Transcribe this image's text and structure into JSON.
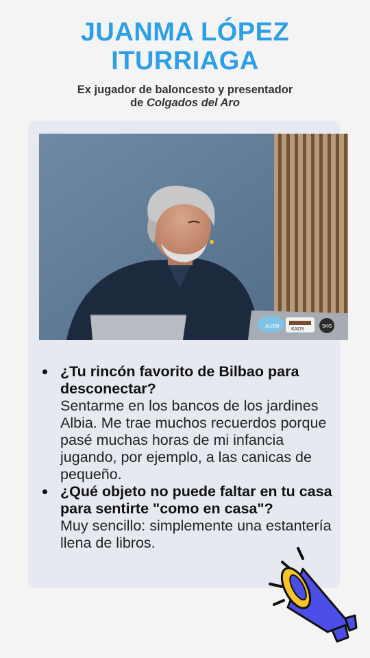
{
  "header": {
    "title_line1": "JUANMA LÓPEZ",
    "title_line2": "ITURRIAGA",
    "subtitle_line1": "Ex jugador de baloncesto y presentador",
    "subtitle_prefix": "de",
    "subtitle_show": "Colgados del Aro"
  },
  "photo": {
    "laptop_stickers": [
      "ALIEN",
      "KAOS",
      "SKG"
    ]
  },
  "qa": [
    {
      "question": "¿Tu rincón favorito de Bilbao para desconectar?",
      "answer": "Sentarme en los bancos de los jardines Albia. Me trae muchos recuerdos porque pasé muchas horas de mi infancia jugando, por ejemplo, a las canicas de pequeño."
    },
    {
      "question": "¿Qué objeto no puede faltar en tu casa para sentirte \"como en casa\"?",
      "answer": "Muy sencillo: simplemente una estantería llena de libros."
    }
  ],
  "colors": {
    "title": "#2d9fe4",
    "card": "#e6e9f0",
    "megaphone_body": "#4b4fe8",
    "megaphone_bell": "#f7c52b"
  },
  "icons": [
    "megaphone-icon"
  ]
}
